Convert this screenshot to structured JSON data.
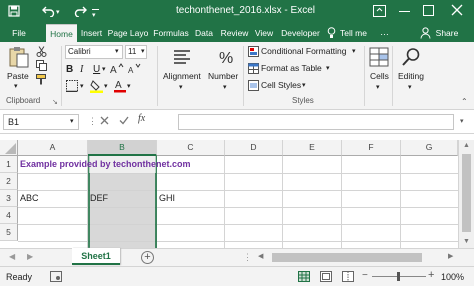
{
  "title": {
    "filename": "techonthenet_2016.xlsx",
    "sep": "-",
    "app": "Excel"
  },
  "tabs": [
    "File",
    "Home",
    "Insert",
    "Page Layo",
    "Formulas",
    "Data",
    "Review",
    "View",
    "Developer"
  ],
  "tell_me": "Tell me",
  "share": "Share",
  "ribbon": {
    "paste": "Paste",
    "clipboard": "Clipboard",
    "font_name": "Calibri",
    "font_size": "11",
    "bold": "B",
    "italic": "I",
    "underline": "U",
    "alignment": "Alignment",
    "number": "Number",
    "conditional": "Conditional Formatting",
    "format_table": "Format as Table",
    "cell_styles": "Cell Styles",
    "styles": "Styles",
    "cells": "Cells",
    "editing": "Editing"
  },
  "formula_bar": {
    "name_box": "B1",
    "fx": "fx",
    "value": ""
  },
  "columns": [
    "A",
    "B",
    "C",
    "D",
    "E",
    "F",
    "G"
  ],
  "rows": [
    "1",
    "2",
    "3",
    "4",
    "5"
  ],
  "cells": {
    "a1": "Example provided by techonthenet.com",
    "a3": "ABC",
    "b3": "DEF",
    "c3": "GHI"
  },
  "sheet_tab": "Sheet1",
  "status": {
    "ready": "Ready",
    "zoom": "100%"
  },
  "colors": {
    "excel_green": "#217346",
    "cell_text_purple": "#7030a0",
    "selection_fill": "#d2d2d2"
  }
}
